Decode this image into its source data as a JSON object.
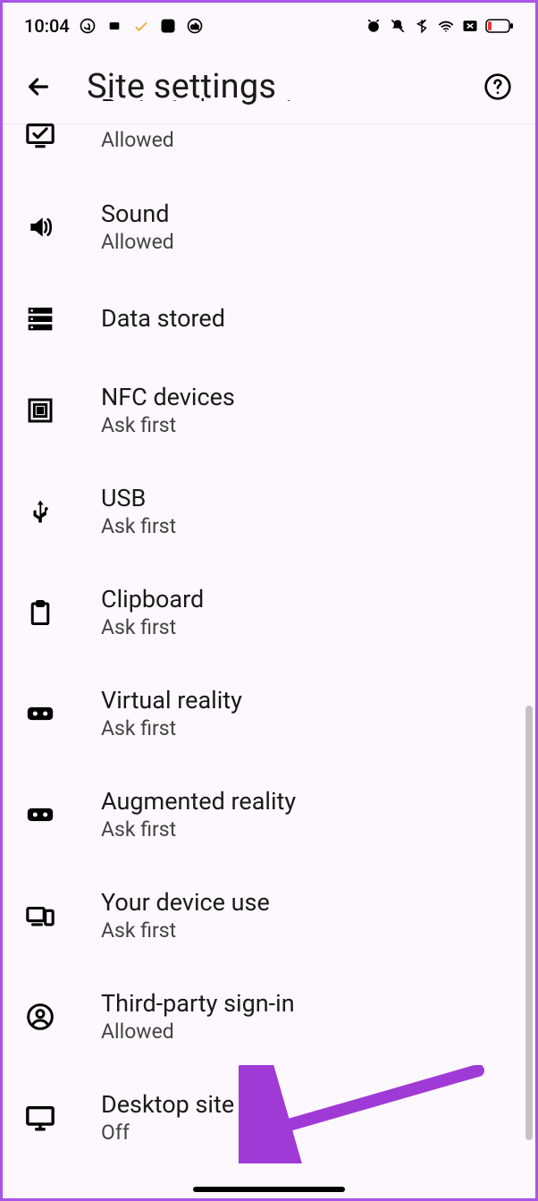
{
  "status_bar": {
    "time": "10:04"
  },
  "header": {
    "title": "Site settings"
  },
  "items": [
    {
      "title": "Protected content",
      "sub": "Allowed"
    },
    {
      "title": "Sound",
      "sub": "Allowed"
    },
    {
      "title": "Data stored",
      "sub": ""
    },
    {
      "title": "NFC devices",
      "sub": "Ask first"
    },
    {
      "title": "USB",
      "sub": "Ask first"
    },
    {
      "title": "Clipboard",
      "sub": "Ask first"
    },
    {
      "title": "Virtual reality",
      "sub": "Ask first"
    },
    {
      "title": "Augmented reality",
      "sub": "Ask first"
    },
    {
      "title": "Your device use",
      "sub": "Ask first"
    },
    {
      "title": "Third-party sign-in",
      "sub": "Allowed"
    },
    {
      "title": "Desktop site",
      "sub": "Off"
    }
  ]
}
